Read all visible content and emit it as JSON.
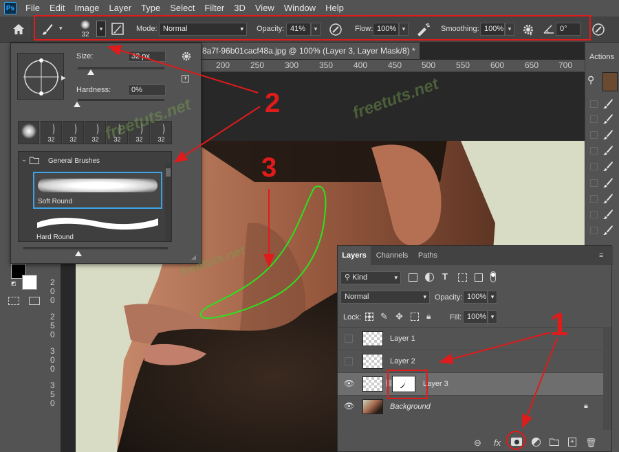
{
  "app": {
    "logo": "Ps",
    "menus": [
      "File",
      "Edit",
      "Image",
      "Layer",
      "Type",
      "Select",
      "Filter",
      "3D",
      "View",
      "Window",
      "Help"
    ]
  },
  "options_bar": {
    "home_icon": "home-icon",
    "brush_size": "32",
    "mode_label": "Mode:",
    "mode_value": "Normal",
    "opacity_label": "Opacity:",
    "opacity_value": "41%",
    "flow_label": "Flow:",
    "flow_value": "100%",
    "smoothing_label": "Smoothing:",
    "smoothing_value": "100%",
    "angle_value": "0°",
    "highlight_color": "#e01b1b"
  },
  "document": {
    "tab_title": "8a7f-96b01cacf48a.jpg @ 100% (Layer 3, Layer Mask/8) *",
    "close_glyph": "×",
    "ruler_top": [
      "200",
      "250",
      "300",
      "350",
      "400",
      "450",
      "500",
      "550",
      "600",
      "650",
      "700"
    ],
    "ruler_left": [
      [
        "2",
        "0",
        "0"
      ],
      [
        "2",
        "5",
        "0"
      ],
      [
        "3",
        "0",
        "0"
      ],
      [
        "3",
        "5",
        "0"
      ]
    ]
  },
  "brush_picker": {
    "size_label": "Size:",
    "size_value": "32 px",
    "hardness_label": "Hardness:",
    "hardness_value": "0%",
    "recent_sizes": [
      "32",
      "32",
      "32",
      "32",
      "32",
      "32"
    ],
    "folder_label": "General Brushes",
    "brushes": [
      {
        "name": "Soft Round",
        "selected": true
      },
      {
        "name": "Hard Round",
        "selected": false
      }
    ]
  },
  "layers_panel": {
    "tabs": [
      "Layers",
      "Channels",
      "Paths"
    ],
    "active_tab": "Layers",
    "filter_kind": "Kind",
    "blend_mode": "Normal",
    "opacity_label": "Opacity:",
    "opacity_value": "100%",
    "lock_label": "Lock:",
    "fill_label": "Fill:",
    "fill_value": "100%",
    "layers": [
      {
        "name": "Layer 1",
        "visible": false,
        "selected": false
      },
      {
        "name": "Layer 2",
        "visible": false,
        "selected": false
      },
      {
        "name": "Layer 3",
        "visible": true,
        "selected": true,
        "has_mask": true
      },
      {
        "name": "Background",
        "visible": true,
        "selected": false,
        "locked": true
      }
    ],
    "footer_fx": "fx"
  },
  "right_panel": {
    "actions_label": "Actions"
  },
  "annotations": {
    "step1": "1",
    "step2": "2",
    "step3": "3",
    "color": "#e01b1b",
    "stroke_color": "#22e01b"
  },
  "watermark": "freetuts.net"
}
